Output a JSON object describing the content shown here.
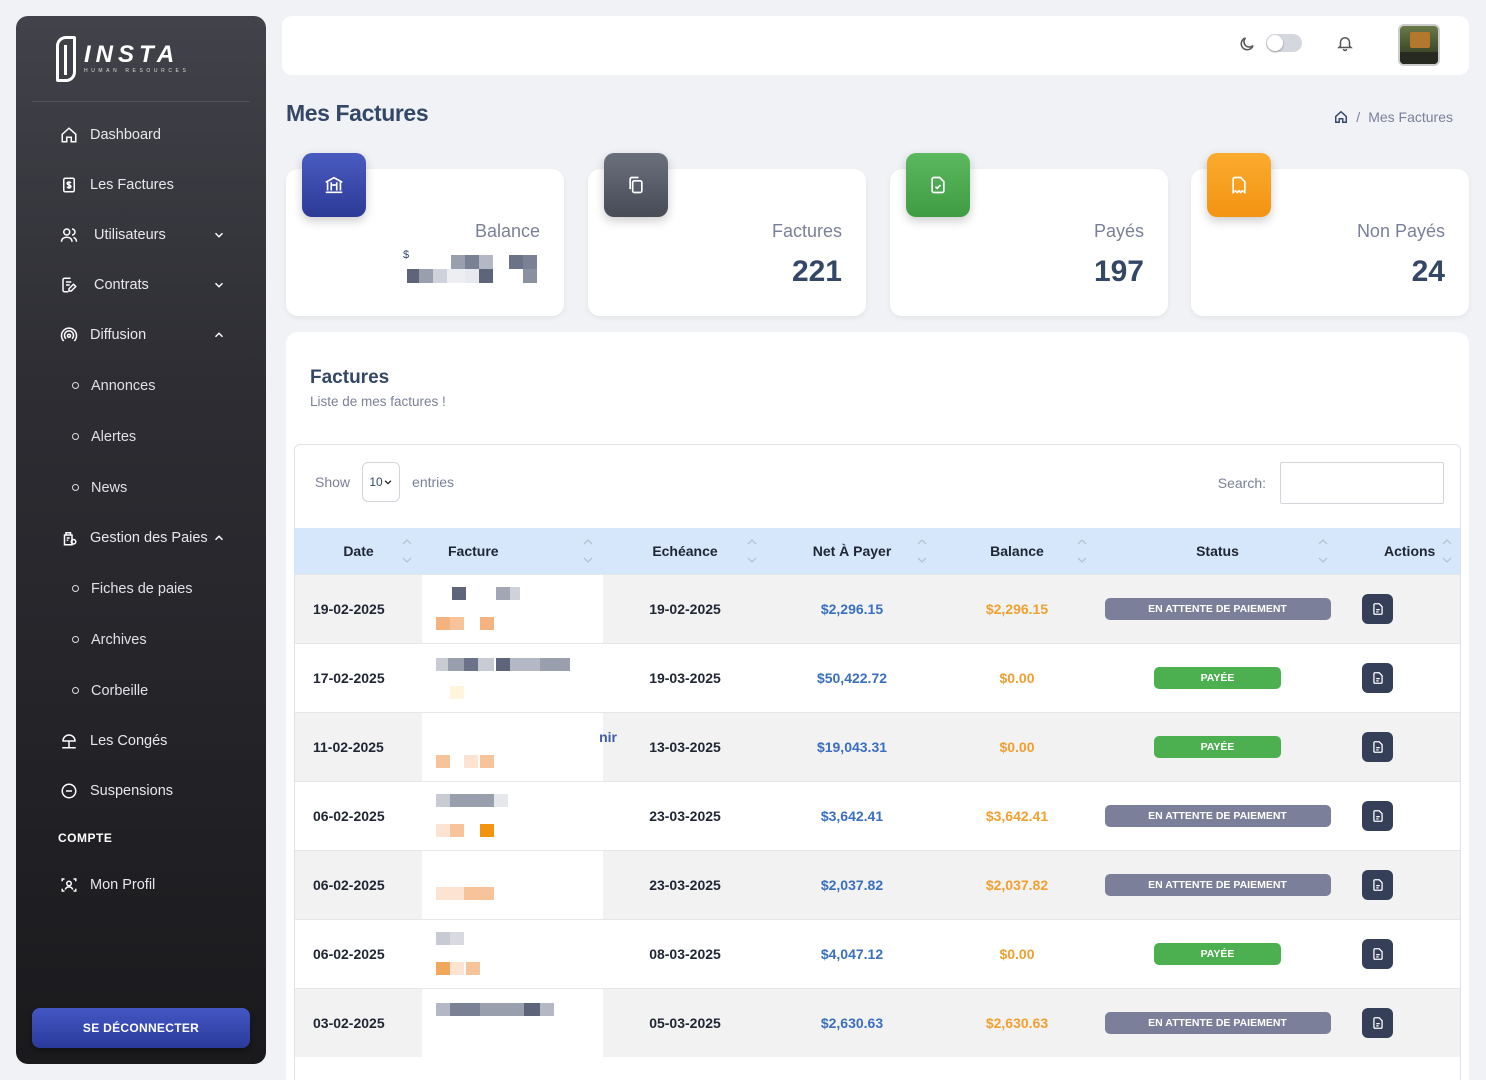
{
  "brand": {
    "name": "INSTA",
    "tagline": "HUMAN RESOURCES"
  },
  "sidebar": {
    "items": [
      {
        "label": "Dashboard",
        "icon": "home-icon"
      },
      {
        "label": "Les Factures",
        "icon": "invoice-icon"
      },
      {
        "label": "Utilisateurs",
        "icon": "users-icon",
        "chevron": "down"
      },
      {
        "label": "Contrats",
        "icon": "contract-icon",
        "chevron": "down"
      },
      {
        "label": "Diffusion",
        "icon": "broadcast-icon",
        "chevron": "up"
      }
    ],
    "diffusion_sub": [
      "Annonces",
      "Alertes",
      "News"
    ],
    "paies": {
      "label": "Gestion des Paies",
      "icon": "payroll-icon",
      "chevron": "up"
    },
    "paies_sub": [
      "Fiches de paies",
      "Archives",
      "Corbeille"
    ],
    "more": [
      {
        "label": "Les Congés",
        "icon": "vacation-icon"
      },
      {
        "label": "Suspensions",
        "icon": "minus-circle-icon"
      }
    ],
    "section_heading": "COMPTE",
    "profile": {
      "label": "Mon Profil",
      "icon": "profile-scan-icon"
    },
    "logout_label": "SE DÉCONNECTER"
  },
  "page": {
    "title": "Mes Factures",
    "breadcrumb": {
      "separator": "/",
      "current": "Mes Factures"
    }
  },
  "stats": [
    {
      "label": "Balance",
      "currency": "$",
      "value": "",
      "color": "#3a4aa8",
      "icon": "bank-icon"
    },
    {
      "label": "Factures",
      "value": "221",
      "color": "#5d6270",
      "icon": "copy-icon"
    },
    {
      "label": "Payés",
      "value": "197",
      "color": "#4caf50",
      "icon": "file-check-icon"
    },
    {
      "label": "Non Payés",
      "value": "24",
      "color": "#f7a01e",
      "icon": "receipt-icon"
    }
  ],
  "card": {
    "title": "Factures",
    "subtitle": "Liste de mes factures !"
  },
  "datatable": {
    "show_label": "Show",
    "length_value": "10",
    "entries_label": "entries",
    "search_label": "Search:",
    "columns": [
      "Date",
      "Facture",
      "Echéance",
      "Net À Payer",
      "Balance",
      "Status",
      "Actions"
    ],
    "rows": [
      {
        "date": "19-02-2025",
        "due": "19-02-2025",
        "net": "$2,296.15",
        "balance": "$2,296.15",
        "status": "EN ATTENTE DE PAIEMENT",
        "paid": false
      },
      {
        "date": "17-02-2025",
        "due": "19-03-2025",
        "net": "$50,422.72",
        "balance": "$0.00",
        "status": "PAYÉE",
        "paid": true
      },
      {
        "date": "11-02-2025",
        "due": "13-03-2025",
        "net": "$19,043.31",
        "balance": "$0.00",
        "status": "PAYÉE",
        "paid": true,
        "facture_fragment": "nir"
      },
      {
        "date": "06-02-2025",
        "due": "23-03-2025",
        "net": "$3,642.41",
        "balance": "$3,642.41",
        "status": "EN ATTENTE DE PAIEMENT",
        "paid": false
      },
      {
        "date": "06-02-2025",
        "due": "23-03-2025",
        "net": "$2,037.82",
        "balance": "$2,037.82",
        "status": "EN ATTENTE DE PAIEMENT",
        "paid": false
      },
      {
        "date": "06-02-2025",
        "due": "08-03-2025",
        "net": "$4,047.12",
        "balance": "$0.00",
        "status": "PAYÉE",
        "paid": true
      },
      {
        "date": "03-02-2025",
        "due": "05-03-2025",
        "net": "$2,630.63",
        "balance": "$2,630.63",
        "status": "EN ATTENTE DE PAIEMENT",
        "paid": false
      }
    ]
  },
  "colors": {
    "accent": "#3a4aa8",
    "paid": "#4caf50",
    "pending": "#7b7f99",
    "net": "#3a6fbf",
    "balance": "#f0a030"
  }
}
